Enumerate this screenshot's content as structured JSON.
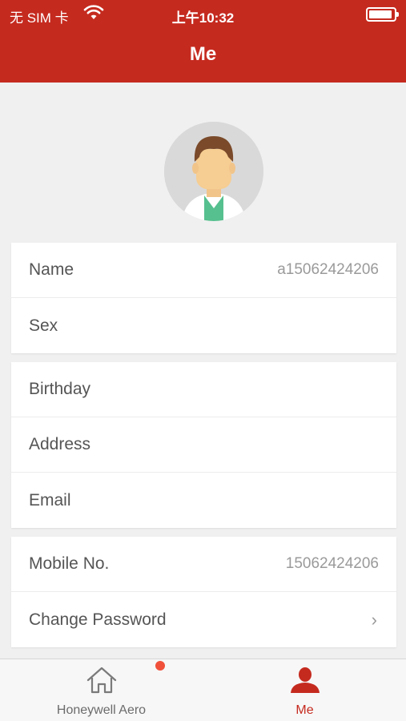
{
  "status_bar": {
    "carrier": "无 SIM 卡",
    "time": "上午10:32"
  },
  "header": {
    "title": "Me"
  },
  "profile": {
    "avatar_icon": "person-avatar-icon",
    "groups": [
      [
        {
          "label": "Name",
          "value": "a15062424206"
        },
        {
          "label": "Sex",
          "value": ""
        }
      ],
      [
        {
          "label": "Birthday",
          "value": ""
        },
        {
          "label": "Address",
          "value": ""
        },
        {
          "label": "Email",
          "value": ""
        }
      ],
      [
        {
          "label": "Mobile No.",
          "value": "15062424206"
        },
        {
          "label": "Change Password",
          "value": "",
          "chevron": "›"
        }
      ]
    ]
  },
  "tabbar": {
    "tabs": [
      {
        "label": "Honeywell Aero",
        "icon": "home-icon",
        "has_badge": true
      },
      {
        "label": "Me",
        "icon": "person-icon",
        "active": true
      }
    ]
  },
  "colors": {
    "brand": "#c52a1f",
    "background": "#f0f0f0",
    "badge": "#f0503a"
  }
}
